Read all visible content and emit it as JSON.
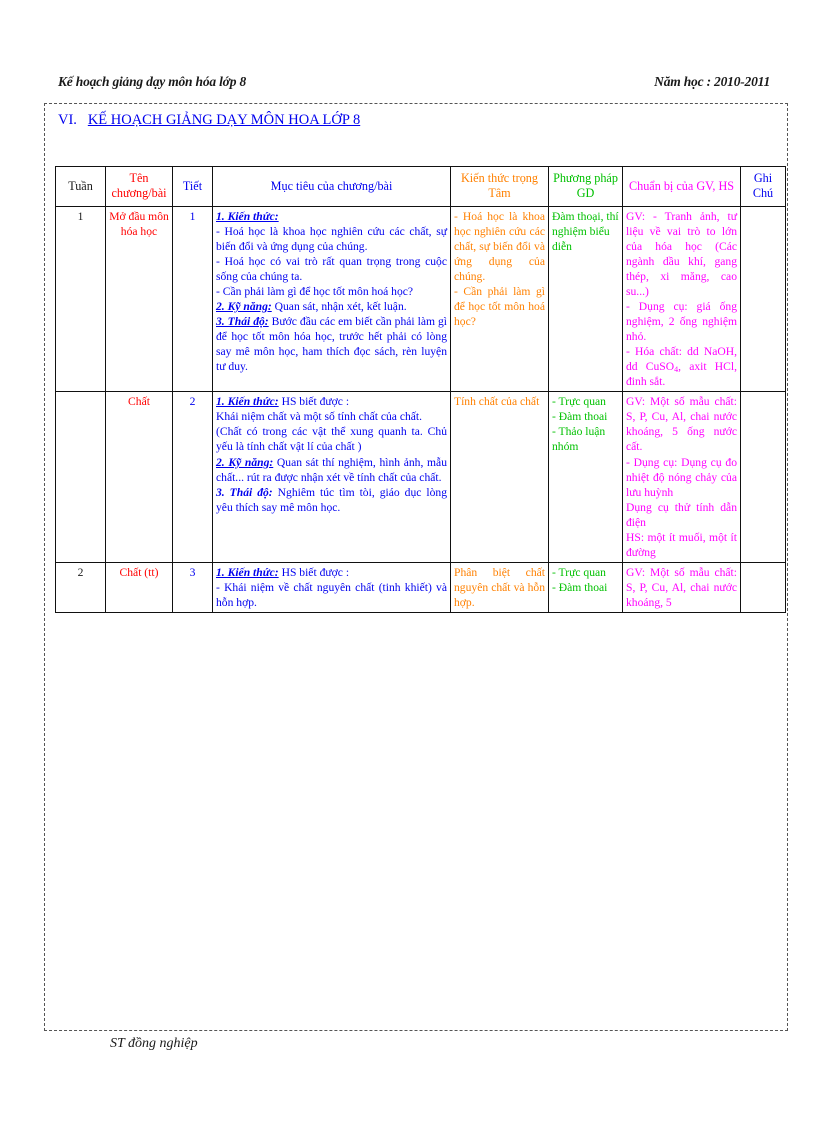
{
  "header": {
    "left": "Kế hoạch giảng dạy môn hóa lớp 8",
    "right": "Năm học : 2010-2011"
  },
  "section": {
    "number": "VI.",
    "title": "KẾ HOẠCH GIẢNG DẠY  MÔN HOA LỚP 8"
  },
  "table": {
    "columns": [
      {
        "key": "tuan",
        "label": "Tuần",
        "color": "#1a1a1a"
      },
      {
        "key": "ten",
        "label": "Tên chương/bài",
        "color": "#ff0000"
      },
      {
        "key": "tiet",
        "label": "Tiết",
        "color": "#0000ee"
      },
      {
        "key": "muc",
        "label": "Mục tiêu của chương/bài",
        "color": "#0000ee"
      },
      {
        "key": "kien",
        "label": "Kiến thức trọng Tâm",
        "color": "#ff8000"
      },
      {
        "key": "phuong",
        "label": "Phương pháp GD",
        "color": "#00c000"
      },
      {
        "key": "chuan",
        "label": "Chuẩn bị của GV, HS",
        "color": "#ff00ff"
      },
      {
        "key": "ghi",
        "label": "Ghi Chú",
        "color": "#0000ee"
      }
    ],
    "rows": [
      {
        "tuan": "1",
        "ten": "Mở đầu môn hóa học",
        "tiet": "1",
        "muc_label_1": "1. Kiến thức:",
        "muc_lines": [
          "- Hoá học là khoa học nghiên cứu các chất, sự biến đổi và ứng dụng của chúng.",
          "- Hoá học có vai trò rất quan trọng trong cuộc sống của chúng ta.",
          "- Cần phải làm gì để học tốt môn hoá học?"
        ],
        "muc_label_2": "2. Kỹ năng:",
        "muc_text_2": " Quan sát, nhận xét, kết luận.",
        "muc_label_3": "3. Thái độ:",
        "muc_text_3": " Bước đầu các em biết cần phải làm gì để học tốt môn hóa học, trước hết phải có lòng say mê môn học, ham thích đọc sách, rèn luyện tư duy.",
        "kien": [
          "- Hoá học là khoa học nghiên cứu các chất, sự biến đổi và ứng dụng của chúng.",
          "- Cần phải làm gì để học tốt môn hoá học?"
        ],
        "phuong": [
          "Đàm thoại, thí nghiệm biểu diễn"
        ],
        "chuan": [
          "GV: - Tranh ảnh, tư liệu về vai trò to lớn của hóa học (Các ngành dầu khí, gang thép, xi măng, cao su...)",
          " - Dụng cụ: giá ống nghiệm, 2 ống nghiệm nhỏ.",
          " - Hóa chất: dd NaOH, dd CuSO4, axit HCl, đinh sắt."
        ],
        "ghi": ""
      },
      {
        "tuan": "",
        "ten": "Chất",
        "tiet": "2",
        "muc_label_1": "1. Kiến thức:",
        "muc_text_1": " HS biết được :",
        "muc_lines": [
          "Khái niệm chất và một số tính chất của chất.",
          "(Chất có trong các vật thể xung quanh ta. Chủ yếu là tính chất vật lí của chất )"
        ],
        "muc_label_2": "2. Kỹ năng:",
        "muc_text_2": " Quan sát thí nghiệm, hình ảnh, mẫu chất... rút ra được nhận xét về tính chất của chất.",
        "muc_label_3": "3. Thái độ:",
        "muc_text_3": " Nghiêm túc tìm tòi, giáo dục lòng yêu thích say mê môn học.",
        "kien": [
          "Tính chất của chất"
        ],
        "phuong": [
          "- Trực quan",
          "- Đàm thoai",
          "- Thảo luận nhóm"
        ],
        "chuan": [
          "GV: Một số mẫu chất: S, P, Cu, Al, chai nước khoáng, 5 ống nước cất.",
          " - Dụng cụ: Dụng cụ đo nhiệt độ nóng chảy của lưu huỳnh",
          " Dụng cụ thử tính dẫn điện",
          "HS: một ít muối, một ít đường"
        ],
        "ghi": ""
      },
      {
        "tuan": "2",
        "ten": "Chất (tt)",
        "tiet": "3",
        "muc_label_1": "1. Kiến thức:",
        "muc_text_1": " HS biết được :",
        "muc_lines": [
          "- Khái niệm về chất nguyên chất (tinh khiết) và hỗn hợp."
        ],
        "kien": [
          "Phân biệt chất nguyên chất và hỗn hợp."
        ],
        "phuong": [
          "- Trực quan",
          "- Đàm thoai"
        ],
        "chuan": [
          "GV: Một số mẫu chất: S, P, Cu, Al, chai nước khoáng, 5"
        ],
        "ghi": ""
      }
    ]
  },
  "footer": {
    "text": "ST đồng nghiệp"
  }
}
